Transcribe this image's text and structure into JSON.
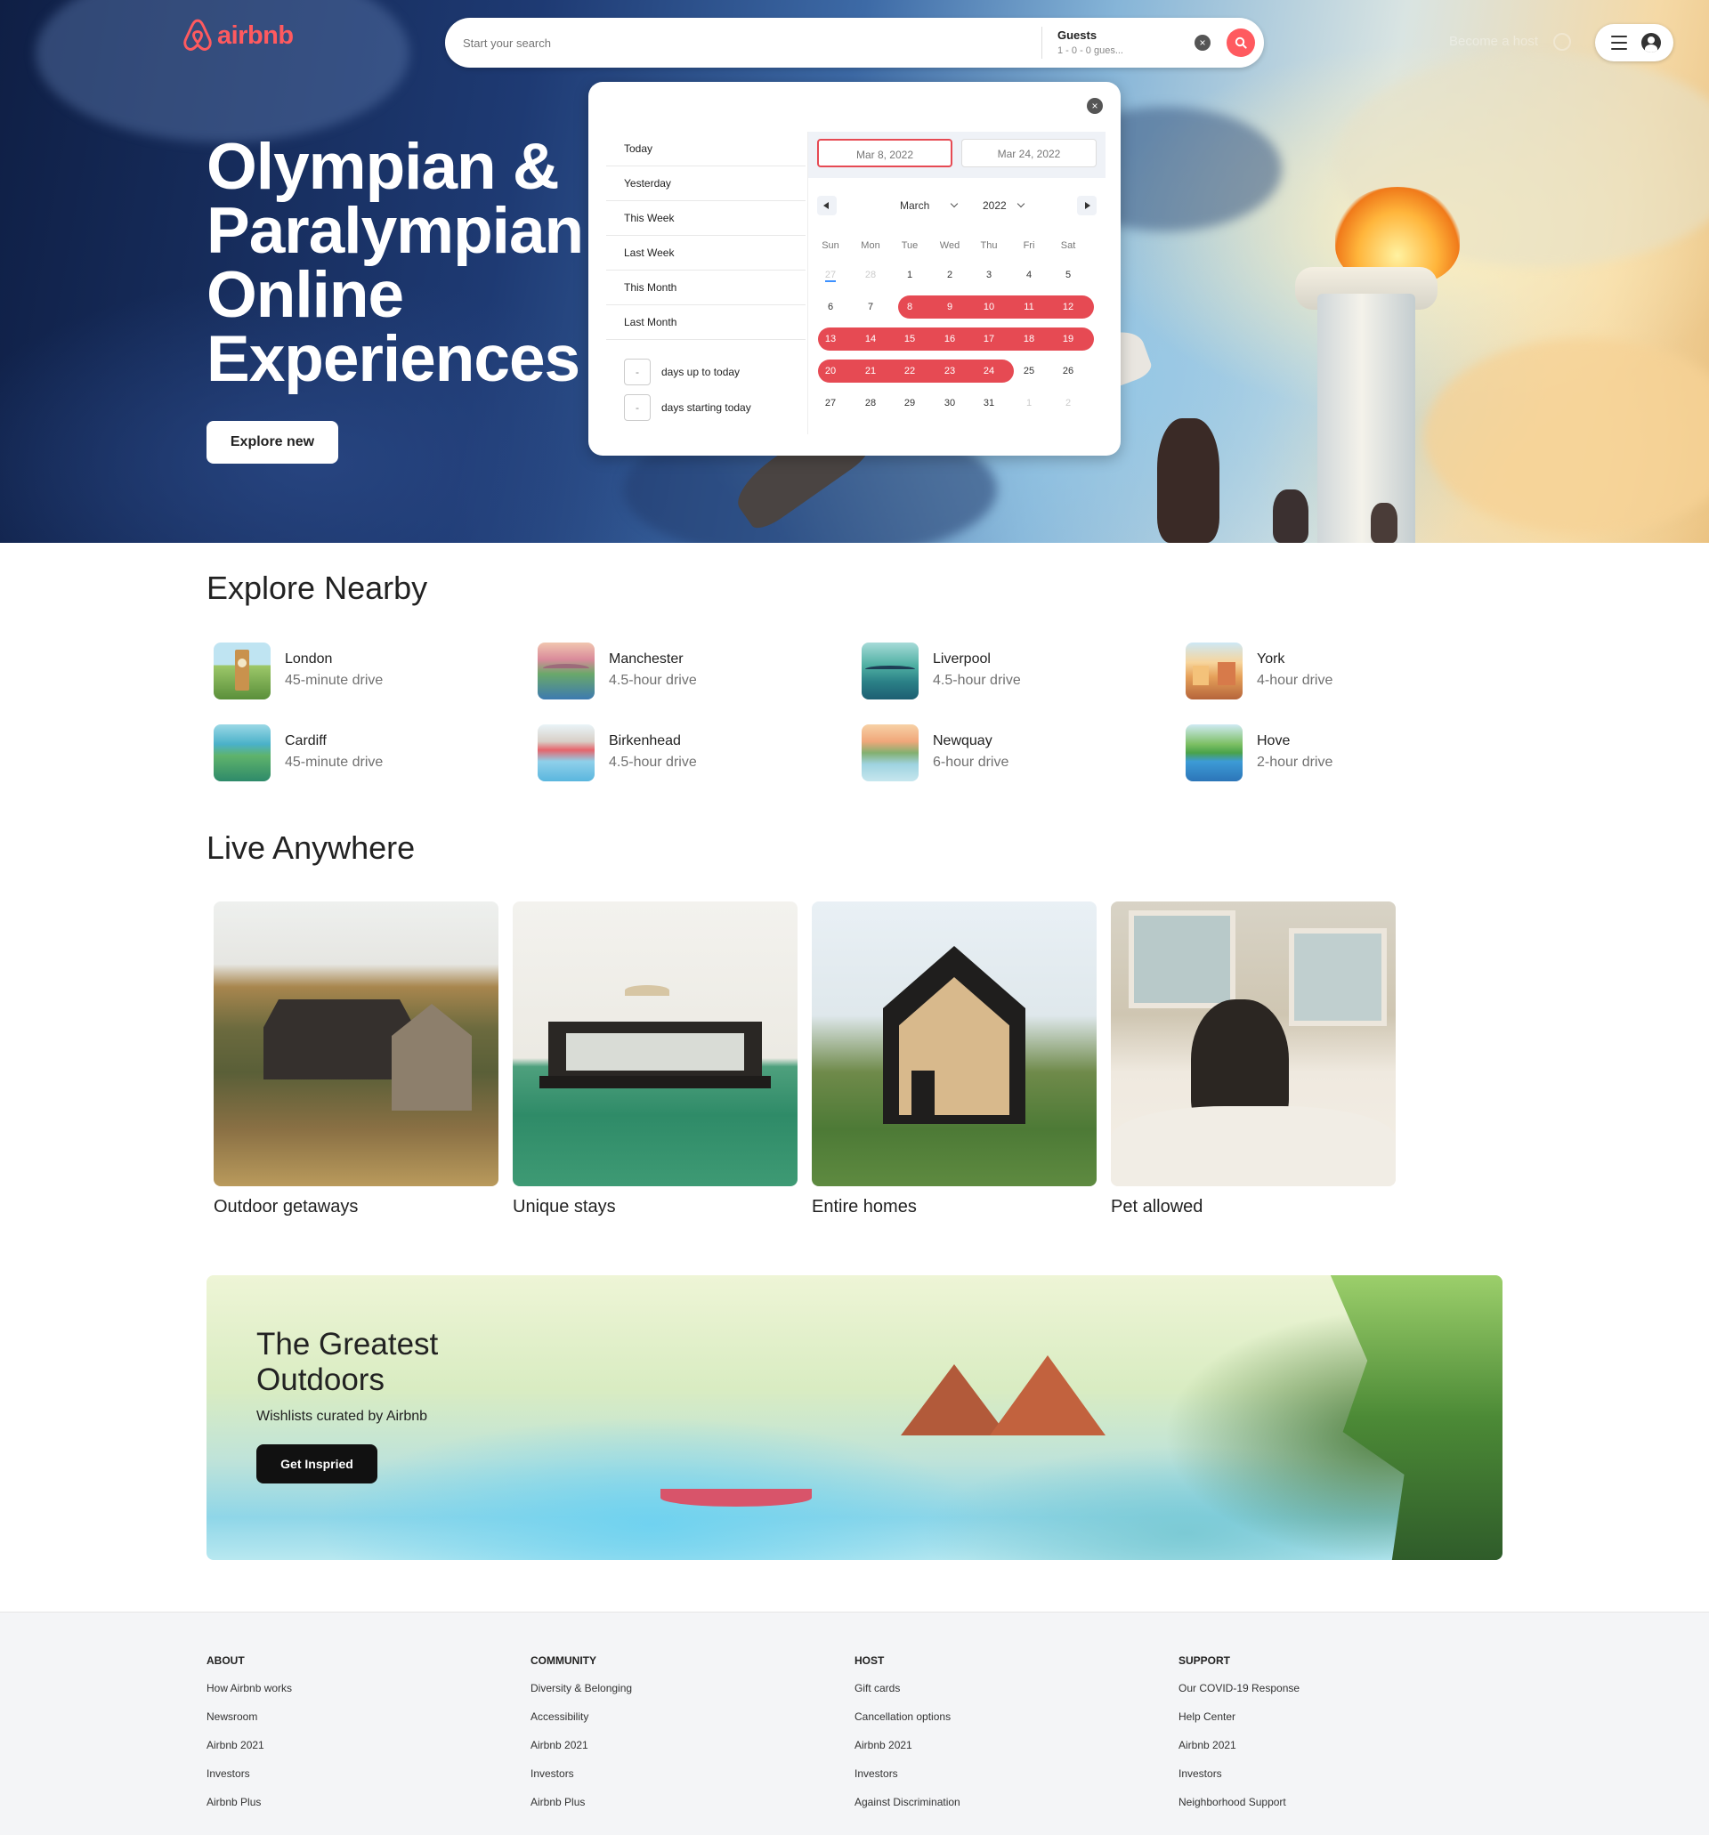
{
  "header": {
    "logo_text": "airbnb",
    "search_placeholder": "Start your search",
    "guests_label": "Guests",
    "guests_value": "1 - 0 - 0 gues...",
    "clear_icon": "×",
    "become_host": "Become a host",
    "brand_color": "#ff5a5f"
  },
  "hero": {
    "title": "Olympian & Paralympian Online Experiences",
    "cta": "Explore new"
  },
  "datepicker": {
    "close_icon": "×",
    "static_ranges": [
      "Today",
      "Yesterday",
      "This Week",
      "Last Week",
      "This Month",
      "Last Month"
    ],
    "input_ranges": [
      {
        "value": "-",
        "label": "days up to today"
      },
      {
        "value": "-",
        "label": "days starting today"
      }
    ],
    "start_date": "Mar 8, 2022",
    "end_date": "Mar 24, 2022",
    "month": "March",
    "year": "2022",
    "weekdays": [
      "Sun",
      "Mon",
      "Tue",
      "Wed",
      "Thu",
      "Fri",
      "Sat"
    ],
    "range_color": "#e64a53",
    "weeks": [
      [
        "27",
        "28",
        "1",
        "2",
        "3",
        "4",
        "5"
      ],
      [
        "6",
        "7",
        "8",
        "9",
        "10",
        "11",
        "12"
      ],
      [
        "13",
        "14",
        "15",
        "16",
        "17",
        "18",
        "19"
      ],
      [
        "20",
        "21",
        "22",
        "23",
        "24",
        "25",
        "26"
      ],
      [
        "27",
        "28",
        "29",
        "30",
        "31",
        "1",
        "2"
      ]
    ]
  },
  "explore_nearby": {
    "title": "Explore Nearby",
    "items": [
      {
        "city": "London",
        "drive": "45-minute drive"
      },
      {
        "city": "Manchester",
        "drive": "4.5-hour drive"
      },
      {
        "city": "Liverpool",
        "drive": "4.5-hour drive"
      },
      {
        "city": "York",
        "drive": "4-hour drive"
      },
      {
        "city": "Cardiff",
        "drive": "45-minute drive"
      },
      {
        "city": "Birkenhead",
        "drive": "4.5-hour drive"
      },
      {
        "city": "Newquay",
        "drive": "6-hour drive"
      },
      {
        "city": "Hove",
        "drive": "2-hour drive"
      }
    ]
  },
  "live_anywhere": {
    "title": "Live Anywhere",
    "cards": [
      {
        "label": "Outdoor getaways"
      },
      {
        "label": "Unique stays"
      },
      {
        "label": "Entire homes"
      },
      {
        "label": "Pet allowed"
      }
    ]
  },
  "banner": {
    "title": "The Greatest Outdoors",
    "subtitle": "Wishlists curated by Airbnb",
    "cta": "Get Inspried"
  },
  "footer": {
    "columns": [
      {
        "heading": "ABOUT",
        "links": [
          "How Airbnb works",
          "Newsroom",
          "Airbnb 2021",
          "Investors",
          "Airbnb Plus"
        ]
      },
      {
        "heading": "COMMUNITY",
        "links": [
          "Diversity & Belonging",
          "Accessibility",
          "Airbnb 2021",
          "Investors",
          "Airbnb Plus"
        ]
      },
      {
        "heading": "HOST",
        "links": [
          "Gift cards",
          "Cancellation options",
          "Airbnb 2021",
          "Investors",
          "Against Discrimination"
        ]
      },
      {
        "heading": "SUPPORT",
        "links": [
          "Our COVID-19 Response",
          "Help Center",
          "Airbnb 2021",
          "Investors",
          "Neighborhood Support"
        ]
      }
    ]
  }
}
